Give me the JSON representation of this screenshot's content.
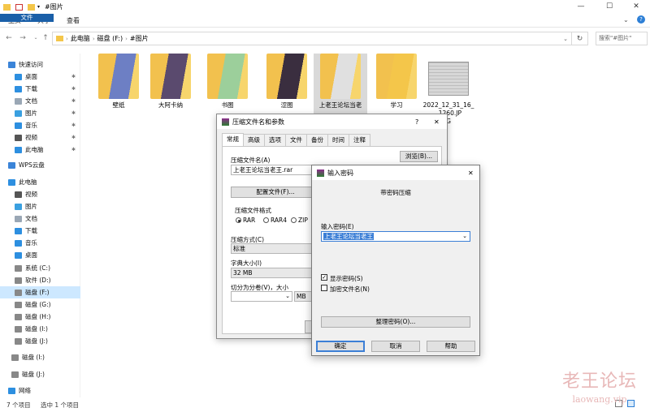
{
  "window": {
    "title": "#图片",
    "minimize": "—",
    "maximize": "☐",
    "close": "✕"
  },
  "ribbon": {
    "tabs": [
      "文件",
      "主页",
      "共享",
      "查看"
    ],
    "expand": "⌄",
    "help": "?"
  },
  "address": {
    "crumbs": [
      "此电脑",
      "磁盘 (F:)",
      "#图片"
    ],
    "search_placeholder": "搜索\"#图片\""
  },
  "sidebar": {
    "items": [
      {
        "label": "快速访问",
        "icon": "star-icon",
        "color": "#3b84d8"
      },
      {
        "label": "桌面",
        "icon": "desktop-icon",
        "color": "#2d8fe0",
        "pinned": true
      },
      {
        "label": "下载",
        "icon": "download-icon",
        "color": "#2d8fe0",
        "pinned": true
      },
      {
        "label": "文档",
        "icon": "document-icon",
        "color": "#9aa7b5",
        "pinned": true
      },
      {
        "label": "图片",
        "icon": "pictures-icon",
        "color": "#3aa0e0",
        "pinned": true
      },
      {
        "label": "音乐",
        "icon": "music-icon",
        "color": "#2d8fe0",
        "pinned": true
      },
      {
        "label": "视频",
        "icon": "video-icon",
        "color": "#555",
        "pinned": true
      },
      {
        "label": "此电脑",
        "icon": "computer-icon",
        "color": "#2d8fe0",
        "pinned": true
      },
      {
        "label": "WPS云盘",
        "icon": "cloud-icon",
        "color": "#3b84d8"
      },
      {
        "label": "此电脑",
        "icon": "computer-icon",
        "color": "#2d8fe0"
      },
      {
        "label": "视频",
        "icon": "video-icon",
        "color": "#555"
      },
      {
        "label": "图片",
        "icon": "pictures-icon",
        "color": "#3aa0e0"
      },
      {
        "label": "文档",
        "icon": "document-icon",
        "color": "#9aa7b5"
      },
      {
        "label": "下载",
        "icon": "download-icon",
        "color": "#2d8fe0"
      },
      {
        "label": "音乐",
        "icon": "music-icon",
        "color": "#2d8fe0"
      },
      {
        "label": "桌面",
        "icon": "desktop-icon",
        "color": "#2d8fe0"
      },
      {
        "label": "系统 (C:)",
        "icon": "drive-icon",
        "color": "#888"
      },
      {
        "label": "软件 (D:)",
        "icon": "drive-icon",
        "color": "#888"
      },
      {
        "label": "磁盘 (F:)",
        "icon": "drive-icon",
        "color": "#888",
        "selected": true
      },
      {
        "label": "磁盘 (G:)",
        "icon": "drive-icon",
        "color": "#888"
      },
      {
        "label": "磁盘 (H:)",
        "icon": "drive-icon",
        "color": "#888"
      },
      {
        "label": "磁盘 (I:)",
        "icon": "drive-icon",
        "color": "#888"
      },
      {
        "label": "磁盘 (J:)",
        "icon": "drive-icon",
        "color": "#888"
      },
      {
        "label": "磁盘 (I:)",
        "icon": "drive-icon",
        "color": "#888"
      },
      {
        "label": "磁盘 (J:)",
        "icon": "drive-icon",
        "color": "#888"
      },
      {
        "label": "网络",
        "icon": "network-icon",
        "color": "#2d8fe0"
      }
    ]
  },
  "files": [
    {
      "label": "壁纸",
      "kind": "folder"
    },
    {
      "label": "大阿卡纳",
      "kind": "folder"
    },
    {
      "label": "书图",
      "kind": "folder"
    },
    {
      "label": "涩图",
      "kind": "folder"
    },
    {
      "label": "上老王论坛当老",
      "kind": "folder",
      "selected": true
    },
    {
      "label": "学习",
      "kind": "folder"
    },
    {
      "label": "2022_12_31_16_",
      "label2": "_1260.JP",
      "label3": "G",
      "kind": "image"
    }
  ],
  "status": {
    "count": "7 个项目",
    "selection": "选中 1 个项目"
  },
  "dlg1": {
    "title": "压缩文件名和参数",
    "tabs": [
      "常规",
      "高级",
      "选项",
      "文件",
      "备份",
      "时间",
      "注释"
    ],
    "archive_label": "压缩文件名(A)",
    "archive_value": "上老王论坛当老王.rar",
    "browse": "浏览(B)...",
    "profile": "配置文件(F)...",
    "format_label": "压缩文件格式",
    "formats": [
      "RAR",
      "RAR4",
      "ZIP"
    ],
    "method_label": "压缩方式(C)",
    "method_value": "标准",
    "dict_label": "字典大小(I)",
    "dict_value": "32 MB",
    "split_label": "切分为分卷(V)，大小",
    "split_unit": "MB"
  },
  "dlg2": {
    "title": "输入密码",
    "heading": "带密码压缩",
    "pwd_label": "输入密码(E)",
    "pwd_value": "上老王论坛当老王",
    "show_pwd": "显示密码(S)",
    "encrypt_names": "加密文件名(N)",
    "manage": "整理密码(O)...",
    "ok": "确定",
    "cancel": "取消",
    "help": "帮助"
  },
  "watermark": {
    "cn": "老王论坛",
    "en": "laowang.vip"
  }
}
